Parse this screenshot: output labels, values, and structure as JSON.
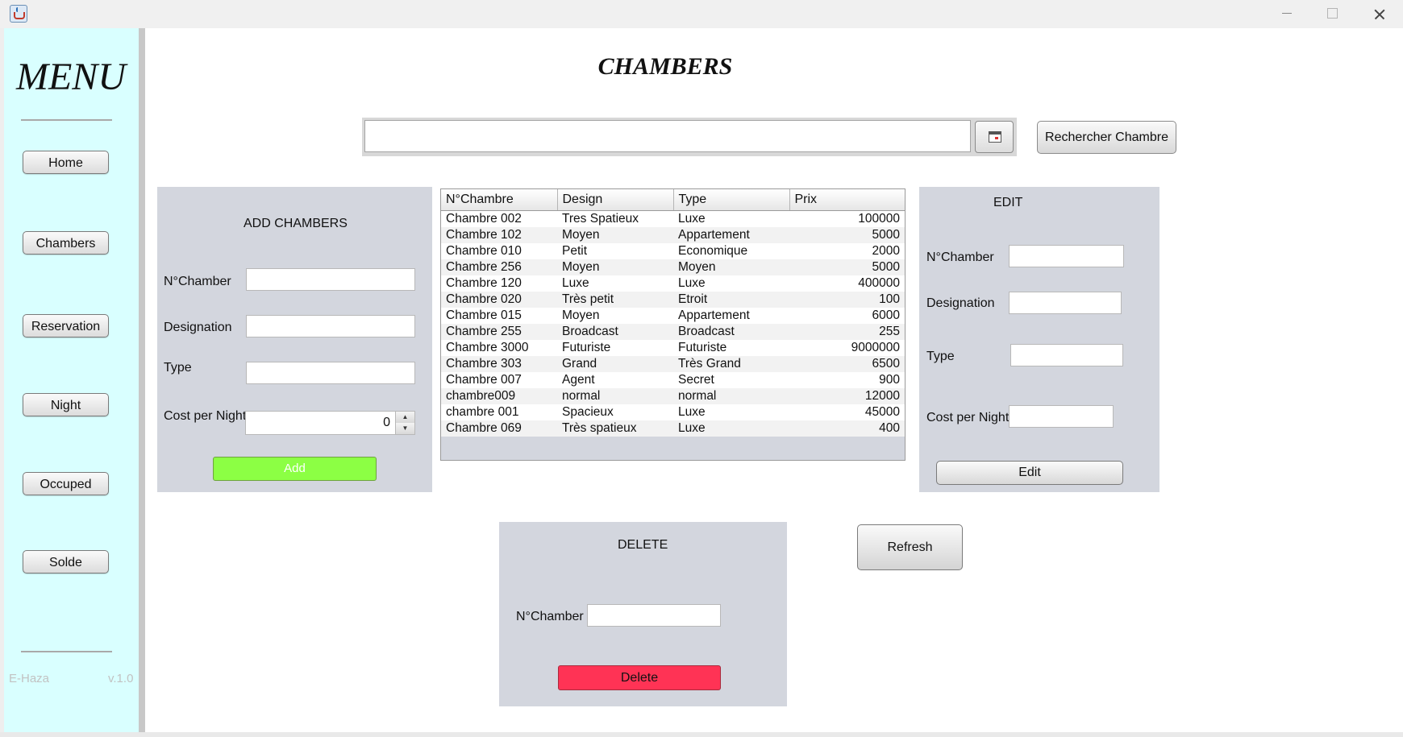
{
  "window": {
    "icon": "java-cup-icon",
    "controls": [
      "minimize",
      "maximize",
      "close"
    ]
  },
  "sidebar": {
    "title": "MENU",
    "items": [
      {
        "label": "Home"
      },
      {
        "label": "Chambers"
      },
      {
        "label": "Reservation"
      },
      {
        "label": "Night"
      },
      {
        "label": "Occuped"
      },
      {
        "label": "Solde"
      }
    ],
    "footer_left": "E-Haza",
    "footer_right": "v.1.0",
    "background_color": "#d9ffff"
  },
  "main": {
    "title": "CHAMBERS",
    "search": {
      "value": "",
      "placeholder": "",
      "calendar_icon": "calendar-icon",
      "button_label": "Rechercher Chambre"
    },
    "add_panel": {
      "title": "ADD CHAMBERS",
      "number_label": "N°Chamber",
      "designation_label": "Designation",
      "type_label": "Type",
      "cost_label": "Cost per Night",
      "cost_value": "0",
      "button_label": "Add",
      "button_color": "#8cff44"
    },
    "table": {
      "columns": [
        "N°Chambre",
        "Design",
        "Type",
        "Prix"
      ],
      "rows": [
        [
          "Chambre 002",
          "Tres Spatieux",
          "Luxe",
          "100000"
        ],
        [
          "Chambre 102",
          "Moyen",
          "Appartement",
          "5000"
        ],
        [
          "Chambre 010",
          "Petit",
          "Economique",
          "2000"
        ],
        [
          "Chambre 256",
          "Moyen",
          "Moyen",
          "5000"
        ],
        [
          "Chambre 120",
          "Luxe",
          "Luxe",
          "400000"
        ],
        [
          "Chambre 020",
          "Très petit",
          "Etroit",
          "100"
        ],
        [
          "Chambre 015",
          "Moyen",
          "Appartement",
          "6000"
        ],
        [
          "Chambre 255",
          "Broadcast",
          "Broadcast",
          "255"
        ],
        [
          "Chambre 3000",
          "Futuriste",
          "Futuriste",
          "9000000"
        ],
        [
          "Chambre 303",
          "Grand",
          "Très Grand",
          "6500"
        ],
        [
          "Chambre 007",
          "Agent",
          "Secret",
          "900"
        ],
        [
          "chambre009",
          "normal",
          "normal",
          "12000"
        ],
        [
          "chambre 001",
          "Spacieux",
          "Luxe",
          "45000"
        ],
        [
          "Chambre 069",
          "Très spatieux",
          "Luxe",
          "400"
        ]
      ]
    },
    "edit_panel": {
      "title": "EDIT",
      "number_label": "N°Chamber",
      "designation_label": "Designation",
      "type_label": "Type",
      "cost_label": "Cost per Night",
      "button_label": "Edit"
    },
    "delete_panel": {
      "title": "DELETE",
      "number_label": "N°Chamber",
      "button_label": "Delete",
      "button_color": "#ff3355"
    },
    "refresh_label": "Refresh"
  }
}
